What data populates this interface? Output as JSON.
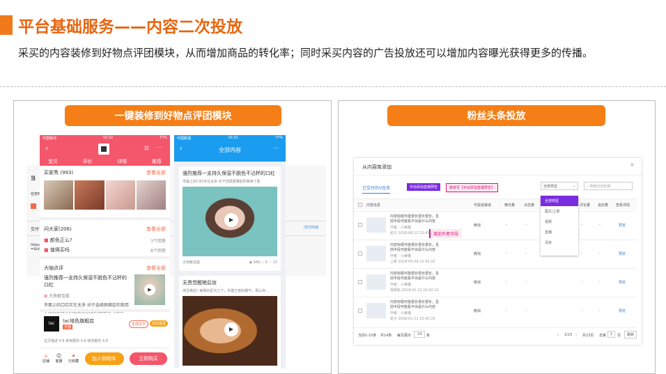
{
  "header": {
    "title": "平台基础服务——内容二次投放",
    "subtitle": "采买的内容装修到好物点评团模块，从而增加商品的转化率；同时采买内容的广告投放还可以增加内容曝光获得更多的传播。"
  },
  "left_panel": {
    "pill": "一键装修到好物点评团模块",
    "phone1": {
      "status_carrier": "中国移动",
      "status_time": "10:32",
      "status_battery": "77%",
      "tabs": [
        "宝贝",
        "评价",
        "详情",
        "推荐"
      ],
      "buyer_show": {
        "title": "买家秀 (993)",
        "see_all": "查看全部"
      },
      "ask": {
        "title": "问大家(206)",
        "see_all": "查看全部",
        "q1": "颜色正么?",
        "q1_count": "3个回答",
        "q2": "值得买吗",
        "q2_count": "8个回答"
      },
      "review": {
        "title": "大咖点评",
        "see_all": "查看全部",
        "headline": "强烈推荐一支持久保湿不脱色不沾杯的口红",
        "author": "大侠献宝能",
        "body": "市面上的口红实在太多·对于选择困难症的我用了能挑挨推荐的这支抱色豪的口红嘛叫嘛画"
      },
      "shop": {
        "logo": "lac",
        "name": "lac培色旗舰店",
        "badge": "天猫",
        "all_items": "全部宝贝",
        "enter": "进店逛逛",
        "scores": "宝贝描述 4.8  卖家服务 4.8  物流服务 4.8"
      },
      "bottom": {
        "i1": "店铺",
        "i2": "客服",
        "i3": "已收藏",
        "cart": "加入购物车",
        "buy": "立即购买"
      },
      "behind": {
        "l1": "当",
        "l2": "任务E",
        "tab": "交付详",
        "url": "https://t\n=&id",
        "tag": "l交付内容"
      }
    },
    "phone2": {
      "status_carrier": "中国联通",
      "status_time": "10:32",
      "status_battery": "77%",
      "title": "全部内容",
      "card1": {
        "title": "强烈推荐一支持久保湿不脱色不沾杯的口红",
        "desc": "市面上的口红实在太多·对于选择困难症的我用了能",
        "author": "大侠献宝能",
        "views": "566",
        "comments": "0",
        "likes": "13"
      },
      "card2": {
        "title": "无畏觉醒艳后妆",
        "desc": "埃及艳后? 璀璨的星光之下，外露王者的霸气，那么你..."
      }
    }
  },
  "right_panel": {
    "pill": "粉丝头条投放",
    "window": {
      "title": "从内容库添加",
      "tab": "已交付的V任务",
      "btn1": "手动添加直播预告",
      "btn2": "跳转至【手动添加直播预告】",
      "select": "全部类型",
      "search": "搜索内容标题",
      "columns": [
        "内容信息",
        "可投放渠道",
        "曝光量",
        "点击量",
        "",
        "",
        "",
        "评论量",
        "",
        "进店量",
        "查看详情"
      ],
      "dropdown": [
        "全部类型",
        "图文/上新",
        "视频",
        "直播",
        "清单"
      ],
      "tooltip": "增加作者字段",
      "rows": [
        {
          "t": "内容标题可能很长很长很长，且前半段可能看不出是什么内容",
          "a": "作者：小美猫",
          "d": "帖子  2018-06-12 15:42:22",
          "ch": "微淘",
          "link": "预览"
        },
        {
          "t": "内容标题可能很长很长很长，且前半段可能看不出是什么内容",
          "a": "作者：小美猫",
          "d": "上新  2018-05-09 15:42:22",
          "ch": "微淘",
          "link": "预览"
        },
        {
          "t": "内容标题可能很长很长很长，且前半段可能看不出是什么内容",
          "a": "作者：小美猫",
          "d": "视频帖  2018-01-12 15:42:22",
          "ch": "微淘",
          "link": "预览"
        },
        {
          "t": "内容标题可能很长很长很长，且前半段可能看不出是什么内容",
          "a": "作者：小美猫",
          "d": "帖子  2018-01-12 15:42:22",
          "ch": "微淘",
          "link": "预览"
        }
      ],
      "footer": {
        "range": "当前1-10条",
        "total": "共14条",
        "per_page": "每页展示",
        "per_val": "14",
        "unit": "条",
        "pager": "1/23",
        "total_pages": "共23页",
        "goto": "去第",
        "goto_val": "1",
        "page": "页",
        "jump": "跳转"
      }
    }
  }
}
